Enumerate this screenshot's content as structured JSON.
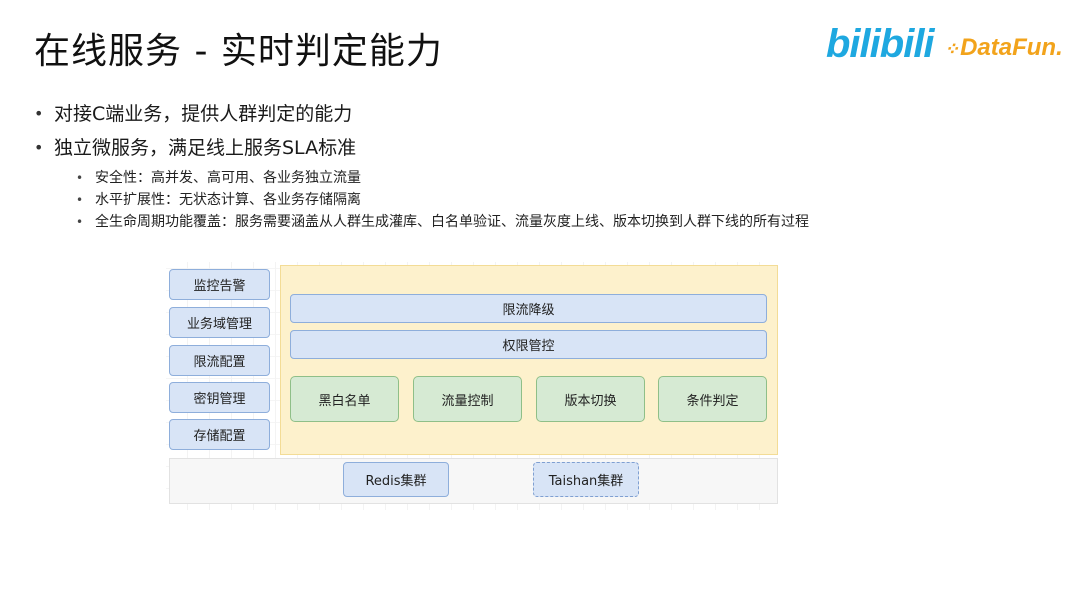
{
  "slide": {
    "title": "在线服务 - 实时判定能力",
    "logos": {
      "bilibili": "bilibili",
      "datafun": "DataFun."
    }
  },
  "bullets": {
    "main1": "对接C端业务，提供人群判定的能力",
    "main2": "独立微服务，满足线上服务SLA标准",
    "sub1": "安全性：高并发、高可用、各业务独立流量",
    "sub2": "水平扩展性：无状态计算、各业务存储隔离",
    "sub3": "全生命周期功能覆盖：服务需要涵盖从人群生成灌库、白名单验证、流量灰度上线、版本切换到人群下线的所有过程"
  },
  "diagram": {
    "left_boxes": [
      "监控告警",
      "业务域管理",
      "限流配置",
      "密钥管理",
      "存储配置"
    ],
    "bars": [
      "限流降级",
      "权限管控"
    ],
    "features": [
      "黑白名单",
      "流量控制",
      "版本切换",
      "条件判定"
    ],
    "storage": [
      "Redis集群",
      "Taishan集群"
    ]
  },
  "colors": {
    "yellow_bg": "#fdf1cc",
    "blue_box": "#d8e4f6",
    "green_box": "#d6ead3",
    "bilibili": "#1ea8e0",
    "datafun": "#f2a31b"
  }
}
